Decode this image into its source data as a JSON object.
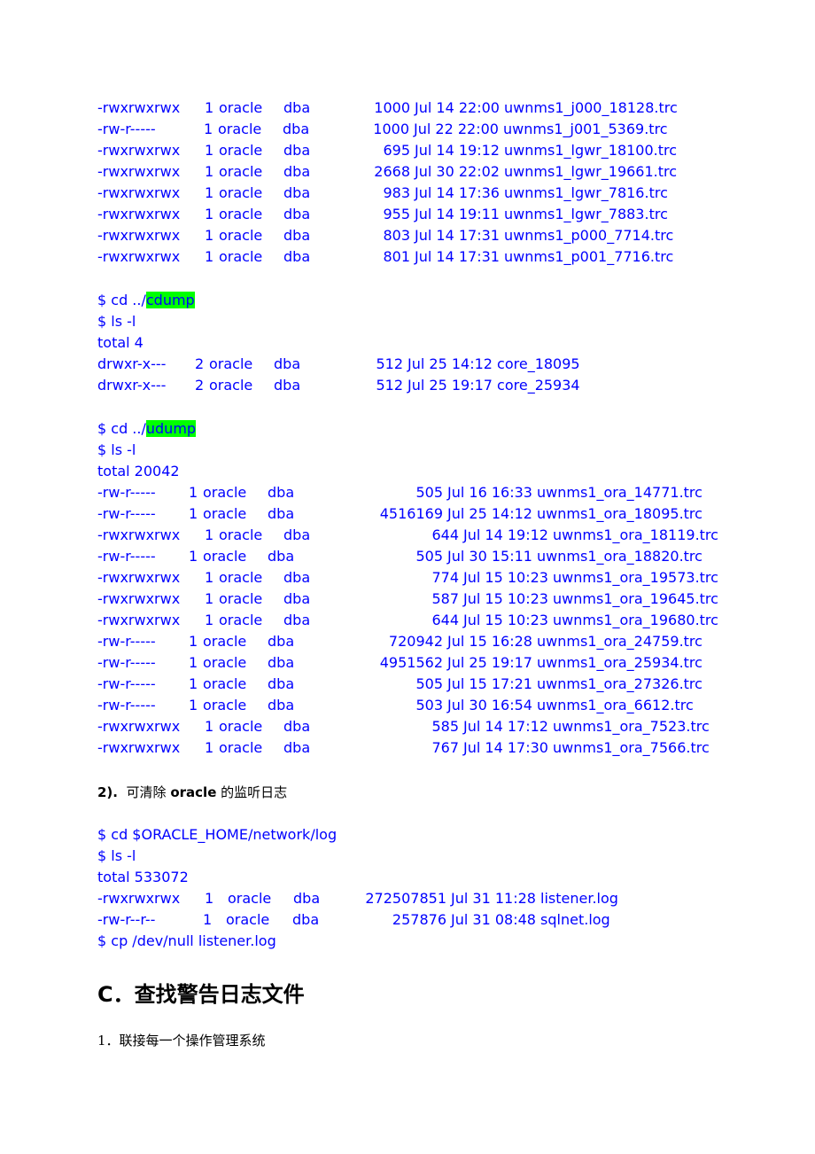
{
  "bdump_listing": {
    "rows": [
      {
        "perm": "-rwxrwxrwx",
        "links": "1",
        "owner": "oracle",
        "group": "dba",
        "size": "1000",
        "date": "Jul 14 22:00",
        "name": "uwnms1_j000_18128.trc"
      },
      {
        "perm": "-rw-r-----",
        "links": "1",
        "owner": "oracle",
        "group": "dba",
        "size": "1000",
        "date": "Jul 22 22:00",
        "name": "uwnms1_j001_5369.trc"
      },
      {
        "perm": "-rwxrwxrwx",
        "links": "1",
        "owner": "oracle",
        "group": "dba",
        "size": "695",
        "date": "Jul 14 19:12",
        "name": "uwnms1_lgwr_18100.trc"
      },
      {
        "perm": "-rwxrwxrwx",
        "links": "1",
        "owner": "oracle",
        "group": "dba",
        "size": "2668",
        "date": "Jul 30 22:02",
        "name": "uwnms1_lgwr_19661.trc"
      },
      {
        "perm": "-rwxrwxrwx",
        "links": "1",
        "owner": "oracle",
        "group": "dba",
        "size": "983",
        "date": "Jul 14 17:36",
        "name": "uwnms1_lgwr_7816.trc"
      },
      {
        "perm": "-rwxrwxrwx",
        "links": "1",
        "owner": "oracle",
        "group": "dba",
        "size": "955",
        "date": "Jul 14 19:11",
        "name": "uwnms1_lgwr_7883.trc"
      },
      {
        "perm": "-rwxrwxrwx",
        "links": "1",
        "owner": "oracle",
        "group": "dba",
        "size": "803",
        "date": "Jul 14 17:31",
        "name": "uwnms1_p000_7714.trc"
      },
      {
        "perm": "-rwxrwxrwx",
        "links": "1",
        "owner": "oracle",
        "group": "dba",
        "size": "801",
        "date": "Jul 14 17:31",
        "name": "uwnms1_p001_7716.trc"
      }
    ]
  },
  "cdump": {
    "cd_prefix": "$ cd ../",
    "cd_dir": "cdump",
    "ls_cmd": "$ ls -l",
    "total": "total 4",
    "rows": [
      {
        "perm": "drwxr-x---",
        "links": "2",
        "owner": "oracle",
        "group": "dba",
        "size": "512",
        "date": "Jul 25 14:12",
        "name": "core_18095"
      },
      {
        "perm": "drwxr-x---",
        "links": "2",
        "owner": "oracle",
        "group": "dba",
        "size": "512",
        "date": "Jul 25 19:17",
        "name": "core_25934"
      }
    ]
  },
  "udump": {
    "cd_prefix": "$ cd ../",
    "cd_dir": "udump",
    "ls_cmd": "$ ls -l",
    "total": "total 20042",
    "rows": [
      {
        "perm": "-rw-r-----",
        "links": "1",
        "owner": "oracle",
        "group": "dba",
        "size": "505",
        "date": "Jul 16 16:33",
        "name": "uwnms1_ora_14771.trc"
      },
      {
        "perm": "-rw-r-----",
        "links": "1",
        "owner": "oracle",
        "group": "dba",
        "size": "4516169",
        "date": "Jul 25 14:12",
        "name": "uwnms1_ora_18095.trc"
      },
      {
        "perm": "-rwxrwxrwx",
        "links": "1",
        "owner": "oracle",
        "group": "dba",
        "size": "644",
        "date": "Jul 14 19:12",
        "name": "uwnms1_ora_18119.trc"
      },
      {
        "perm": "-rw-r-----",
        "links": "1",
        "owner": "oracle",
        "group": "dba",
        "size": "505",
        "date": "Jul 30 15:11",
        "name": "uwnms1_ora_18820.trc"
      },
      {
        "perm": "-rwxrwxrwx",
        "links": "1",
        "owner": "oracle",
        "group": "dba",
        "size": "774",
        "date": "Jul 15 10:23",
        "name": "uwnms1_ora_19573.trc"
      },
      {
        "perm": "-rwxrwxrwx",
        "links": "1",
        "owner": "oracle",
        "group": "dba",
        "size": "587",
        "date": "Jul 15 10:23",
        "name": "uwnms1_ora_19645.trc"
      },
      {
        "perm": "-rwxrwxrwx",
        "links": "1",
        "owner": "oracle",
        "group": "dba",
        "size": "644",
        "date": "Jul 15 10:23",
        "name": "uwnms1_ora_19680.trc"
      },
      {
        "perm": "-rw-r-----",
        "links": "1",
        "owner": "oracle",
        "group": "dba",
        "size": "720942",
        "date": "Jul 15 16:28",
        "name": "uwnms1_ora_24759.trc"
      },
      {
        "perm": "-rw-r-----",
        "links": "1",
        "owner": "oracle",
        "group": "dba",
        "size": "4951562",
        "date": "Jul 25 19:17",
        "name": "uwnms1_ora_25934.trc"
      },
      {
        "perm": "-rw-r-----",
        "links": "1",
        "owner": "oracle",
        "group": "dba",
        "size": "505",
        "date": "Jul 15 17:21",
        "name": "uwnms1_ora_27326.trc"
      },
      {
        "perm": "-rw-r-----",
        "links": "1",
        "owner": "oracle",
        "group": "dba",
        "size": "503",
        "date": "Jul 30 16:54",
        "name": "uwnms1_ora_6612.trc"
      },
      {
        "perm": "-rwxrwxrwx",
        "links": "1",
        "owner": "oracle",
        "group": "dba",
        "size": "585",
        "date": "Jul 14 17:12",
        "name": "uwnms1_ora_7523.trc"
      },
      {
        "perm": "-rwxrwxrwx",
        "links": "1",
        "owner": "oracle",
        "group": "dba",
        "size": "767",
        "date": "Jul 14 17:30",
        "name": "uwnms1_ora_7566.trc"
      }
    ]
  },
  "listener_section": {
    "heading_num": "2).",
    "heading_pre": "可清除",
    "heading_bold": "oracle",
    "heading_post": "的监听日志",
    "cd_cmd": "$ cd $ORACLE_HOME/network/log",
    "ls_cmd": "$ ls -l",
    "total": "total 533072",
    "rows": [
      {
        "perm": "-rwxrwxrwx",
        "links": "1",
        "owner": "oracle",
        "group": "dba",
        "size": "272507851",
        "date": "Jul 31 11:28",
        "name": "listener.log"
      },
      {
        "perm": "-rw-r--r--",
        "links": "1",
        "owner": "oracle",
        "group": "dba",
        "size": "257876",
        "date": "Jul 31 08:48",
        "name": "sqlnet.log"
      }
    ],
    "cp_cmd": "$ cp /dev/null listener.log"
  },
  "section_c": {
    "heading": "C．查找警告日志文件",
    "step1": "1．联接每一个操作管理系统"
  },
  "colors": {
    "terminal_text": "#0000ff",
    "highlight": "#00ff00",
    "body_text": "#000000"
  }
}
